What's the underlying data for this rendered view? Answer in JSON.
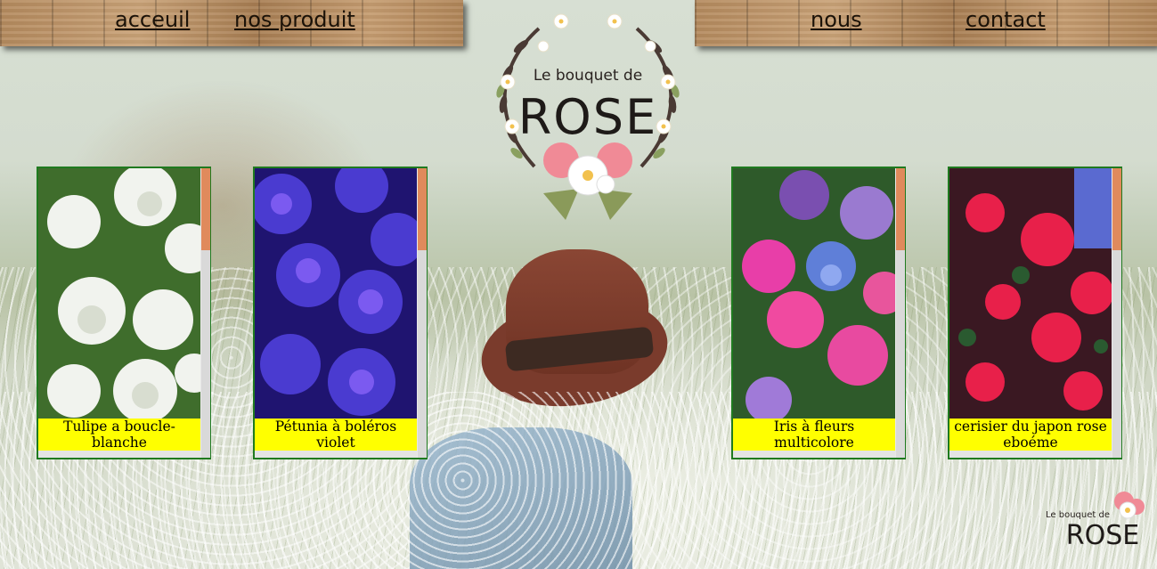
{
  "nav": {
    "left": [
      {
        "label": "acceuil"
      },
      {
        "label": "nos produit"
      }
    ],
    "right": [
      {
        "label": "nous"
      },
      {
        "label": "contact"
      }
    ]
  },
  "logo": {
    "line1": "Le bouquet de",
    "line2": "ROSE"
  },
  "products": [
    {
      "caption": "Tulipe a boucle-blanche"
    },
    {
      "caption": "Pétunia à boléros violet"
    },
    {
      "caption": "Iris à fleurs multicolore"
    },
    {
      "caption": "cerisier du japon rose eboéme"
    }
  ],
  "footer_logo": {
    "line1": "Le bouquet de",
    "line2": "ROSE"
  },
  "colors": {
    "caption_bg": "#ffff00",
    "card_border": "#1f7a1f",
    "scroll_thumb": "#e08a5c"
  }
}
